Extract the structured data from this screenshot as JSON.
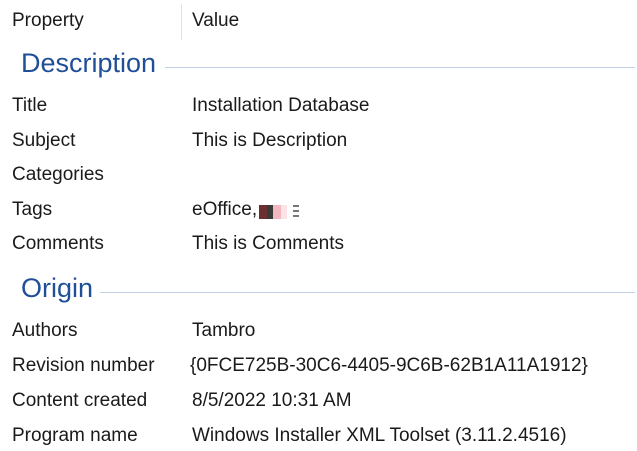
{
  "header": {
    "property": "Property",
    "value": "Value"
  },
  "groups": {
    "description": {
      "title": "Description",
      "rows": [
        {
          "name": "Title",
          "value": "Installation Database"
        },
        {
          "name": "Subject",
          "value": "This is Description"
        },
        {
          "name": "Categories",
          "value": ""
        },
        {
          "name": "Tags",
          "value": "eOffice,"
        },
        {
          "name": "Comments",
          "value": "This is Comments"
        }
      ]
    },
    "origin": {
      "title": "Origin",
      "rows": [
        {
          "name": "Authors",
          "value": "Tambro"
        },
        {
          "name": "Revision number",
          "value": "{0FCE725B-30C6-4405-9C6B-62B1A11A1912}"
        },
        {
          "name": "Content created",
          "value": "8/5/2022 10:31 AM"
        },
        {
          "name": "Program name",
          "value": "Windows Installer XML Toolset (3.11.2.4516)"
        }
      ]
    }
  },
  "colors": {
    "group_title": "#1e4f97",
    "group_line": "#c3cfe6",
    "text": "#1a1a1a"
  }
}
